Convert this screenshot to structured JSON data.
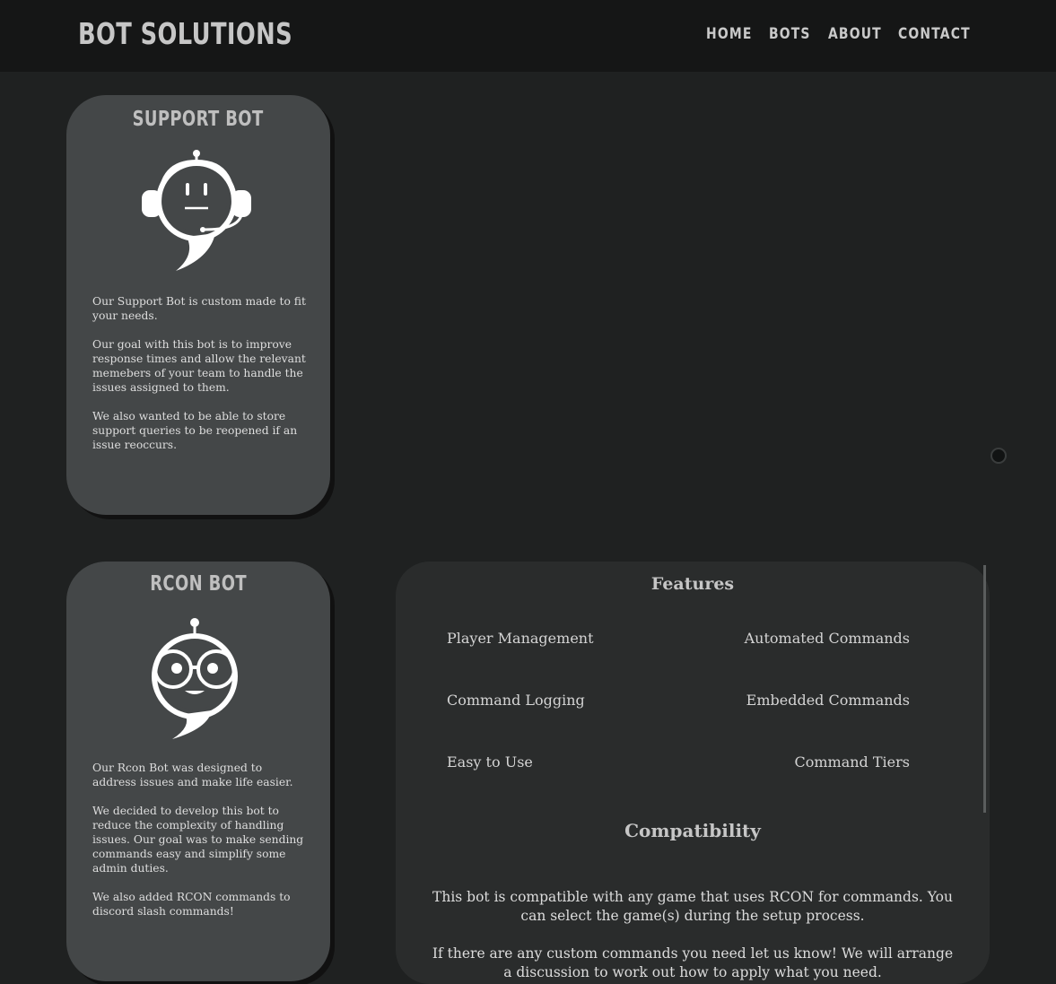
{
  "header": {
    "brand": "BOT SOLUTIONS",
    "nav": [
      "HOME",
      "BOTS",
      "ABOUT",
      "CONTACT"
    ]
  },
  "support_bot": {
    "title": "SUPPORT BOT",
    "icon": "support-bot-headset-icon",
    "paragraphs": [
      "Our Support Bot is custom made to fit your needs.",
      "Our goal with this bot is to improve response times and allow the relevant memebers of your team to handle the issues assigned to them.",
      "We also wanted to be able to store support queries to be reopened if an issue reoccurs."
    ]
  },
  "rcon_bot": {
    "title": "RCON BOT",
    "icon": "rcon-bot-glasses-icon",
    "paragraphs": [
      "Our Rcon Bot was designed to address issues and make life easier.",
      "We decided to develop this bot to reduce the complexity of handling issues. Our goal was to make sending commands easy and simplify some admin duties.",
      "We also added RCON commands to discord slash commands!"
    ]
  },
  "features_panel": {
    "features_heading": "Features",
    "features": [
      "Player Management",
      "Automated Commands",
      "Command Logging",
      "Embedded Commands",
      "Easy to Use",
      "Command Tiers"
    ],
    "compat_heading": "Compatibility",
    "compat_paragraphs": [
      "This bot is compatible with any game that uses RCON for commands. You can select the game(s) during the setup process.",
      "If there are any custom commands you need let us know! We will arrange a discussion to work out how to apply what you need."
    ]
  },
  "colors": {
    "background": "#1f2121",
    "header": "#151616",
    "card": "#444748",
    "panel": "#2a2c2c"
  }
}
